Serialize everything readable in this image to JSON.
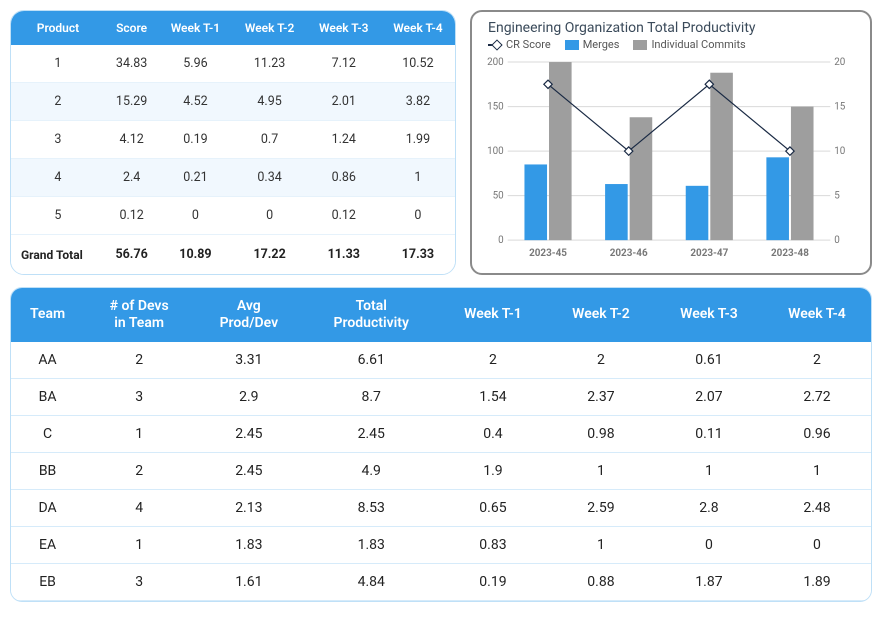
{
  "product_table": {
    "headers": [
      "Product",
      "Score",
      "Week T-1",
      "Week T-2",
      "Week T-3",
      "Week T-4"
    ],
    "rows": [
      [
        "1",
        "34.83",
        "5.96",
        "11.23",
        "7.12",
        "10.52"
      ],
      [
        "2",
        "15.29",
        "4.52",
        "4.95",
        "2.01",
        "3.82"
      ],
      [
        "3",
        "4.12",
        "0.19",
        "0.7",
        "1.24",
        "1.99"
      ],
      [
        "4",
        "2.4",
        "0.21",
        "0.34",
        "0.86",
        "1"
      ],
      [
        "5",
        "0.12",
        "0",
        "0",
        "0.12",
        "0"
      ]
    ],
    "footer": [
      "Grand Total",
      "56.76",
      "10.89",
      "17.22",
      "11.33",
      "17.33"
    ]
  },
  "chart": {
    "title": "Engineering Organization Total Productivity",
    "legend": {
      "cr": "CR Score",
      "merges": "Merges",
      "commits": "Individual Commits"
    }
  },
  "chart_data": {
    "type": "bar",
    "categories": [
      "2023-45",
      "2023-46",
      "2023-47",
      "2023-48"
    ],
    "series": [
      {
        "name": "Merges",
        "values": [
          85,
          63,
          61,
          93
        ],
        "axis": "left",
        "color": "#3399e6"
      },
      {
        "name": "Individual Commits",
        "values": [
          200,
          138,
          188,
          150
        ],
        "axis": "left",
        "color": "#9e9e9e"
      },
      {
        "name": "CR Score",
        "values": [
          17.5,
          10,
          17.5,
          10
        ],
        "axis": "right",
        "type": "line",
        "color": "#1a2a44"
      }
    ],
    "y_left": {
      "min": 0,
      "max": 200,
      "ticks": [
        0,
        50,
        100,
        150,
        200
      ]
    },
    "y_right": {
      "min": 0,
      "max": 20,
      "ticks": [
        0,
        5,
        10,
        15,
        20
      ]
    },
    "title": "Engineering Organization Total Productivity"
  },
  "team_table": {
    "headers": [
      "Team",
      "# of Devs in Team",
      "Avg Prod/Dev",
      "Total Productivity",
      "Week T-1",
      "Week T-2",
      "Week T-3",
      "Week T-4"
    ],
    "rows": [
      [
        "AA",
        "2",
        "3.31",
        "6.61",
        "2",
        "2",
        "0.61",
        "2"
      ],
      [
        "BA",
        "3",
        "2.9",
        "8.7",
        "1.54",
        "2.37",
        "2.07",
        "2.72"
      ],
      [
        "C",
        "1",
        "2.45",
        "2.45",
        "0.4",
        "0.98",
        "0.11",
        "0.96"
      ],
      [
        "BB",
        "2",
        "2.45",
        "4.9",
        "1.9",
        "1",
        "1",
        "1"
      ],
      [
        "DA",
        "4",
        "2.13",
        "8.53",
        "0.65",
        "2.59",
        "2.8",
        "2.48"
      ],
      [
        "EA",
        "1",
        "1.83",
        "1.83",
        "0.83",
        "1",
        "0",
        "0"
      ],
      [
        "EB",
        "3",
        "1.61",
        "4.84",
        "0.19",
        "0.88",
        "1.87",
        "1.89"
      ]
    ]
  }
}
